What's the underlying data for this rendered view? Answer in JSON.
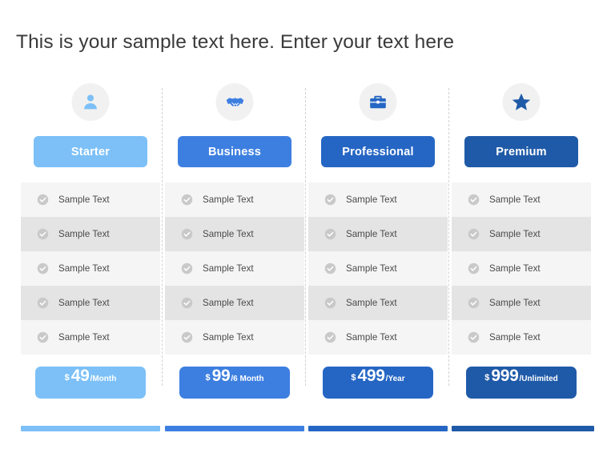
{
  "page": {
    "title": "This is your sample text here. Enter your text here",
    "background_color": "#ffffff",
    "title_color": "#3a3a3a"
  },
  "columns": [
    {
      "id": "starter",
      "plan_label": "Starter",
      "icon": "user-icon",
      "accent_color": "#7cc0f7",
      "icon_color": "#7cc0f7",
      "badge_color": "#f1f1f1",
      "price": {
        "currency": "$",
        "amount": "49",
        "period": "/Month"
      },
      "features": [
        {
          "icon": "check-circle-icon",
          "label": "Sample Text"
        },
        {
          "icon": "check-circle-icon",
          "label": "Sample Text"
        },
        {
          "icon": "check-circle-icon",
          "label": "Sample Text"
        },
        {
          "icon": "check-circle-icon",
          "label": "Sample Text"
        },
        {
          "icon": "check-circle-icon",
          "label": "Sample Text"
        }
      ]
    },
    {
      "id": "business",
      "plan_label": "Business",
      "icon": "handshake-icon",
      "accent_color": "#3d7fe0",
      "icon_color": "#3d7fe0",
      "badge_color": "#f1f1f1",
      "price": {
        "currency": "$",
        "amount": "99",
        "period": "/6 Month"
      },
      "features": [
        {
          "icon": "check-circle-icon",
          "label": "Sample Text"
        },
        {
          "icon": "check-circle-icon",
          "label": "Sample Text"
        },
        {
          "icon": "check-circle-icon",
          "label": "Sample Text"
        },
        {
          "icon": "check-circle-icon",
          "label": "Sample Text"
        },
        {
          "icon": "check-circle-icon",
          "label": "Sample Text"
        }
      ]
    },
    {
      "id": "professional",
      "plan_label": "Professional",
      "icon": "briefcase-icon",
      "accent_color": "#2566c4",
      "icon_color": "#2566c4",
      "badge_color": "#f1f1f1",
      "price": {
        "currency": "$",
        "amount": "499",
        "period": "/Year"
      },
      "features": [
        {
          "icon": "check-circle-icon",
          "label": "Sample Text"
        },
        {
          "icon": "check-circle-icon",
          "label": "Sample Text"
        },
        {
          "icon": "check-circle-icon",
          "label": "Sample Text"
        },
        {
          "icon": "check-circle-icon",
          "label": "Sample Text"
        },
        {
          "icon": "check-circle-icon",
          "label": "Sample Text"
        }
      ]
    },
    {
      "id": "premium",
      "plan_label": "Premium",
      "icon": "star-icon",
      "accent_color": "#1f5aa8",
      "icon_color": "#1f5aa8",
      "badge_color": "#f1f1f1",
      "price": {
        "currency": "$",
        "amount": "999",
        "period": "/Unlimited"
      },
      "features": [
        {
          "icon": "check-circle-icon",
          "label": "Sample Text"
        },
        {
          "icon": "check-circle-icon",
          "label": "Sample Text"
        },
        {
          "icon": "check-circle-icon",
          "label": "Sample Text"
        },
        {
          "icon": "check-circle-icon",
          "label": "Sample Text"
        },
        {
          "icon": "check-circle-icon",
          "label": "Sample Text"
        }
      ]
    }
  ],
  "row_colors": {
    "odd": "#f5f5f5",
    "even": "#e4e4e4"
  },
  "check_icon_color": "#c9c9c9"
}
